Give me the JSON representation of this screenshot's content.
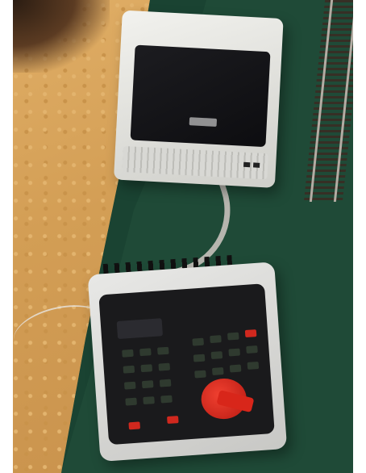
{
  "scene": {
    "kind": "photo",
    "central_station_label": "",
    "handset_brand_label": "",
    "colors": {
      "floor": "#d6a25a",
      "board": "#1f4a37",
      "device_body": "#e8e8e6",
      "screen": "#121216",
      "knob": "#d8261a"
    }
  }
}
